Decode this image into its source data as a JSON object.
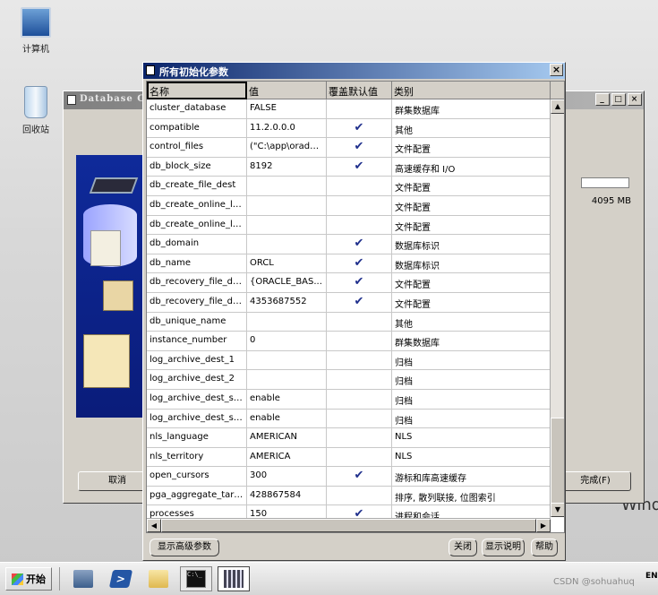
{
  "desktop": {
    "icons": [
      {
        "label": "计算机"
      },
      {
        "label": "回收站"
      }
    ],
    "wallpaper_text": "Wind"
  },
  "background_window": {
    "title": "Database Co",
    "size_text": "4095 MB",
    "cancel_label": "取消",
    "finish_label": "完成(F)"
  },
  "dialog": {
    "title": "所有初始化参数",
    "columns": [
      "名称",
      "值",
      "覆盖默认值",
      "类别"
    ],
    "rows": [
      {
        "name": "cluster_database",
        "value": "FALSE",
        "override": "",
        "category": "群集数据库"
      },
      {
        "name": "compatible",
        "value": "11.2.0.0.0",
        "override": "✔",
        "category": "其他"
      },
      {
        "name": "control_files",
        "value": "(\"C:\\app\\oradat...",
        "override": "✔",
        "category": "文件配置"
      },
      {
        "name": "db_block_size",
        "value": "8192",
        "override": "✔",
        "category": "高速缓存和 I/O"
      },
      {
        "name": "db_create_file_dest",
        "value": "",
        "override": "",
        "category": "文件配置"
      },
      {
        "name": "db_create_online_lo...",
        "value": "",
        "override": "",
        "category": "文件配置"
      },
      {
        "name": "db_create_online_lo...",
        "value": "",
        "override": "",
        "category": "文件配置"
      },
      {
        "name": "db_domain",
        "value": "",
        "override": "✔",
        "category": "数据库标识"
      },
      {
        "name": "db_name",
        "value": "ORCL",
        "override": "✔",
        "category": "数据库标识"
      },
      {
        "name": "db_recovery_file_dest",
        "value": "{ORACLE_BAS...",
        "override": "✔",
        "category": "文件配置"
      },
      {
        "name": "db_recovery_file_de...",
        "value": "4353687552",
        "override": "✔",
        "category": "文件配置"
      },
      {
        "name": "db_unique_name",
        "value": "",
        "override": "",
        "category": "其他"
      },
      {
        "name": "instance_number",
        "value": "0",
        "override": "",
        "category": "群集数据库"
      },
      {
        "name": "log_archive_dest_1",
        "value": "",
        "override": "",
        "category": "归档"
      },
      {
        "name": "log_archive_dest_2",
        "value": "",
        "override": "",
        "category": "归档"
      },
      {
        "name": "log_archive_dest_st...",
        "value": "enable",
        "override": "",
        "category": "归档"
      },
      {
        "name": "log_archive_dest_st...",
        "value": "enable",
        "override": "",
        "category": "归档"
      },
      {
        "name": "nls_language",
        "value": "AMERICAN",
        "override": "",
        "category": "NLS"
      },
      {
        "name": "nls_territory",
        "value": "AMERICA",
        "override": "",
        "category": "NLS"
      },
      {
        "name": "open_cursors",
        "value": "300",
        "override": "✔",
        "category": "游标和库高速缓存"
      },
      {
        "name": "pga_aggregate_target",
        "value": "428867584",
        "override": "",
        "category": "排序, 散列联接, 位图索引"
      },
      {
        "name": "processes",
        "value": "150",
        "override": "✔",
        "category": "进程和会话"
      }
    ],
    "buttons": {
      "advanced": "显示高级参数",
      "close": "关闭",
      "help_desc": "显示说明",
      "help": "帮助"
    }
  },
  "taskbar": {
    "start_label": "开始",
    "cmd_text": "C:\\_",
    "lang": "EN",
    "watermark": "CSDN @sohuahuq"
  }
}
